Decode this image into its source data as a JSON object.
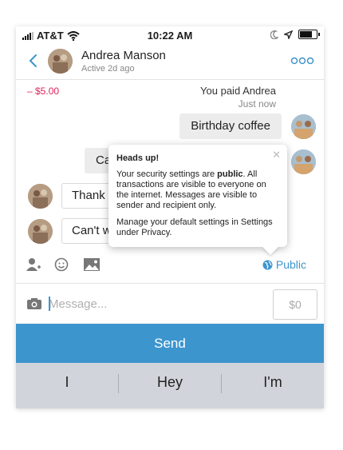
{
  "status_bar": {
    "carrier": "AT&T",
    "time": "10:22 AM"
  },
  "header": {
    "name": "Andrea Manson",
    "subtitle": "Active 2d ago"
  },
  "transaction": {
    "amount": "– $5.00",
    "text": "You paid Andrea",
    "time": "Just now"
  },
  "messages": [
    {
      "text": "Birthday coffee",
      "direction": "out"
    },
    {
      "text": "Ca",
      "direction": "out"
    },
    {
      "text": "Thank",
      "direction": "in"
    },
    {
      "text": "Can't w",
      "direction": "in"
    }
  ],
  "popover": {
    "title": "Heads up!",
    "body_pre": "Your security settings are ",
    "body_bold": "public",
    "body_post": ". All transactions are visible to everyone on the internet. Messages are visible to sender and recipient only.",
    "manage": "Manage your default settings in Settings under Privacy."
  },
  "visibility": {
    "label": "Public"
  },
  "composer": {
    "placeholder": "Message...",
    "amount": "$0"
  },
  "send": {
    "label": "Send"
  },
  "keyboard": {
    "suggestions": [
      "I",
      "Hey",
      "I'm"
    ]
  },
  "colors": {
    "accent": "#3d95ce",
    "negative": "#e0245e"
  }
}
